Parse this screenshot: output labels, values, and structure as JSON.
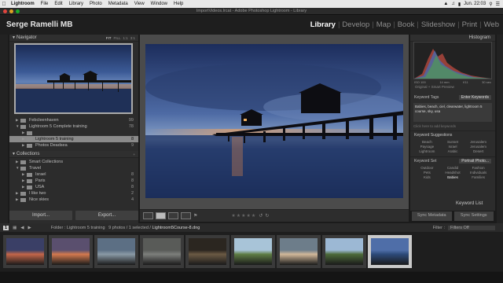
{
  "menubar": {
    "items": [
      "Lightroom",
      "File",
      "Edit",
      "Library",
      "Photo",
      "Metadata",
      "View",
      "Window",
      "Help"
    ],
    "clock": "Jun. 22:03"
  },
  "window": {
    "title": "ImportVideos.lrcat - Adobe Photoshop Lightroom - Library"
  },
  "identity_plate": "Serge Ramelli MB",
  "modules": [
    "Library",
    "Develop",
    "Map",
    "Book",
    "Slideshow",
    "Print",
    "Web"
  ],
  "active_module": "Library",
  "navigator": {
    "title": "Navigator",
    "zoom_options": [
      "FIT",
      "FILL",
      "1:1",
      "3:1"
    ]
  },
  "folders": [
    {
      "label": "Febcleenhaven",
      "count": "99",
      "level": 1,
      "selected": false
    },
    {
      "label": "Lightroom 5 Complete training",
      "count": "78",
      "level": 1,
      "selected": false
    },
    {
      "label": "",
      "count": "",
      "level": 2,
      "selected": false
    },
    {
      "label": "Lightroom 5 training",
      "count": "8",
      "level": 2,
      "selected": true
    },
    {
      "label": "Photos Deadsea",
      "count": "9",
      "level": 2,
      "selected": false
    }
  ],
  "collections": {
    "title": "Collections",
    "items": [
      {
        "label": "Smart Collections",
        "count": ""
      },
      {
        "label": "Travel",
        "count": ""
      },
      {
        "label": "Israel",
        "count": "8"
      },
      {
        "label": "Paris",
        "count": "8"
      },
      {
        "label": "USA",
        "count": "8"
      },
      {
        "label": "I like two",
        "count": "2"
      },
      {
        "label": "Nice skies",
        "count": "4"
      }
    ]
  },
  "left_buttons": {
    "import": "Import...",
    "export": "Export..."
  },
  "right_panel": {
    "histogram_title": "Histogram",
    "hist_meta": [
      "ISO 100",
      "14 mm",
      "f/11",
      "30 sec"
    ],
    "original_label": "Original + Smart Preview",
    "keywording_label": "Keyword Tags",
    "enter_keywords": "Enter Keywords",
    "keywords_text": "Babies, beach, ciel, clearwater, lightroom 5 course, sky, usa",
    "keyword_hint": "Click here to add keywords",
    "keyword_suggestions_label": "Keyword Suggestions",
    "suggestions": [
      "Beach",
      "Sunset",
      "Jerusalem",
      "Paysage",
      "Israel",
      "Jerusalem",
      "Lightroom",
      "Arabic",
      "Desert"
    ],
    "keyword_set_label": "Keyword Set",
    "keyword_set_value": "Portrait Photo...",
    "set_items": [
      "Outdoor",
      "Candid",
      "Fashion",
      "Pets",
      "Headshot",
      "Individuals",
      "Kids",
      "Babies",
      "Families"
    ],
    "keyword_list": "Keyword List",
    "sync_metadata": "Sync Metadata",
    "sync_settings": "Sync Settings"
  },
  "filmstrip_bar": {
    "page": "1",
    "breadcrumb_prefix": "Folder : Lightroom 5 training",
    "breadcrumb_count": "9 photos / 1 selected /",
    "filename": "Lightroom5Course-8.dng",
    "filter_label": "Filter :",
    "filter_value": "Filters Off"
  },
  "filmstrip": [
    {
      "tone": "#c4664a",
      "sky": "#3a3f66",
      "selected": false
    },
    {
      "tone": "#d47a4f",
      "sky": "#5a4f6e",
      "selected": false
    },
    {
      "tone": "#8a9aa6",
      "sky": "#5c6f84",
      "selected": false
    },
    {
      "tone": "#7d7f7c",
      "sky": "#595b58",
      "selected": false
    },
    {
      "tone": "#6b5a44",
      "sky": "#2b2620",
      "selected": false
    },
    {
      "tone": "#5f7d44",
      "sky": "#a8c4d8",
      "selected": false
    },
    {
      "tone": "#d2b89a",
      "sky": "#6d7d8a",
      "selected": false
    },
    {
      "tone": "#4c6a3a",
      "sky": "#9cb8d4",
      "selected": false
    },
    {
      "tone": "#2d4a7a",
      "sky": "#4f6ea8",
      "selected": true
    }
  ]
}
